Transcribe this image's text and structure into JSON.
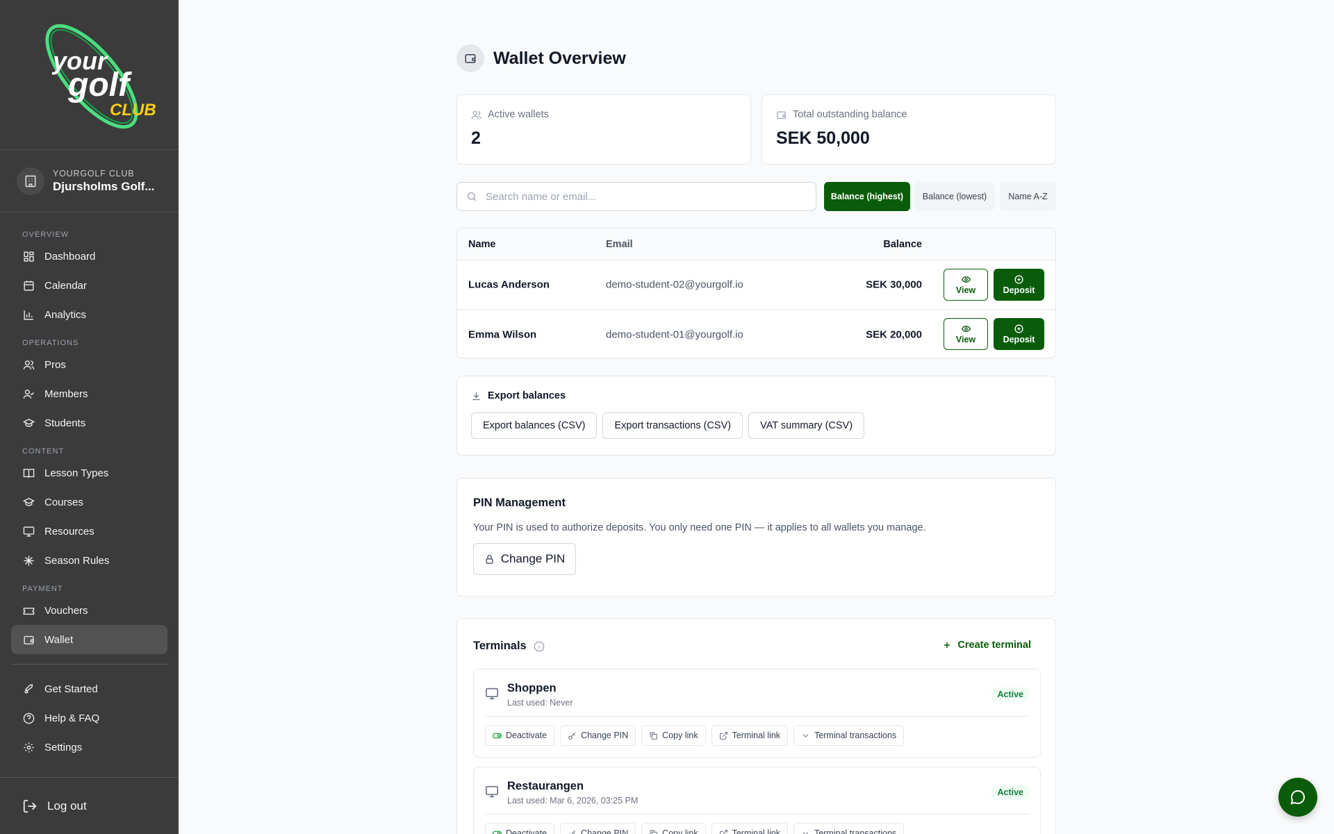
{
  "brand": {
    "logo_text_your": "your",
    "logo_text_golf": "golf",
    "logo_text_club": "CLUB",
    "accent": "#0a5c0a",
    "logo_green": "#4ade80",
    "logo_yellow": "#facc15"
  },
  "club": {
    "kicker": "YOURGOLF CLUB",
    "name": "Djursholms Golf..."
  },
  "sidebar": {
    "sections": [
      {
        "title": "OVERVIEW",
        "items": [
          {
            "label": "Dashboard",
            "icon": "dashboard-icon"
          },
          {
            "label": "Calendar",
            "icon": "calendar-icon"
          },
          {
            "label": "Analytics",
            "icon": "bar-chart-icon"
          }
        ]
      },
      {
        "title": "OPERATIONS",
        "items": [
          {
            "label": "Pros",
            "icon": "users-icon"
          },
          {
            "label": "Members",
            "icon": "user-check-icon"
          },
          {
            "label": "Students",
            "icon": "graduation-cap-icon"
          }
        ]
      },
      {
        "title": "CONTENT",
        "items": [
          {
            "label": "Lesson Types",
            "icon": "book-icon"
          },
          {
            "label": "Courses",
            "icon": "graduation-cap-icon"
          },
          {
            "label": "Resources",
            "icon": "monitor-icon"
          },
          {
            "label": "Season Rules",
            "icon": "snowflake-icon"
          }
        ]
      },
      {
        "title": "PAYMENT",
        "items": [
          {
            "label": "Vouchers",
            "icon": "ticket-icon"
          },
          {
            "label": "Wallet",
            "icon": "wallet-icon",
            "active": true
          }
        ]
      }
    ],
    "footer_items": [
      {
        "label": "Get Started",
        "icon": "rocket-icon"
      },
      {
        "label": "Help & FAQ",
        "icon": "help-circle-icon"
      },
      {
        "label": "Settings",
        "icon": "gear-icon"
      }
    ],
    "logout": "Log out"
  },
  "page": {
    "title": "Wallet Overview"
  },
  "stats": {
    "active_wallets_label": "Active wallets",
    "active_wallets_value": "2",
    "outstanding_label": "Total outstanding balance",
    "outstanding_value": "SEK 50,000"
  },
  "search": {
    "placeholder": "Search name or email..."
  },
  "sort": {
    "options": [
      "Balance (highest)",
      "Balance (lowest)",
      "Name A-Z"
    ],
    "selected": "Balance (highest)"
  },
  "table": {
    "headers": {
      "name": "Name",
      "email": "Email",
      "balance": "Balance"
    },
    "rows": [
      {
        "name": "Lucas Anderson",
        "email": "demo-student-02@yourgolf.io",
        "balance": "SEK 30,000"
      },
      {
        "name": "Emma Wilson",
        "email": "demo-student-01@yourgolf.io",
        "balance": "SEK 20,000"
      }
    ],
    "view_label": "View",
    "deposit_label": "Deposit"
  },
  "export": {
    "title": "Export balances",
    "buttons": [
      "Export balances (CSV)",
      "Export transactions (CSV)",
      "VAT summary (CSV)"
    ]
  },
  "pin": {
    "title": "PIN Management",
    "description": "Your PIN is used to authorize deposits. You only need one PIN — it applies to all wallets you manage.",
    "button": "Change PIN"
  },
  "terminals": {
    "title": "Terminals",
    "create_label": "Create terminal",
    "items": [
      {
        "name": "Shoppen",
        "last_used": "Last used: Never",
        "status": "Active"
      },
      {
        "name": "Restaurangen",
        "last_used": "Last used: Mar 6, 2026, 03:25 PM",
        "status": "Active"
      }
    ],
    "actions": [
      "Deactivate",
      "Change PIN",
      "Copy link",
      "Terminal link",
      "Terminal transactions"
    ]
  }
}
